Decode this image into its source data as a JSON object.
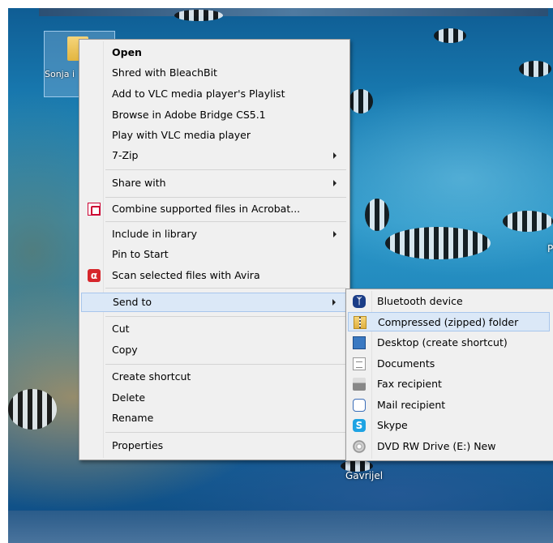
{
  "desktop": {
    "icons": [
      {
        "label": "Sonja i"
      },
      {
        "label": "Gavrijel"
      }
    ],
    "edge_label": "P"
  },
  "context_menu": {
    "items": [
      {
        "label": "Open",
        "bold": true
      },
      {
        "label": "Shred with BleachBit"
      },
      {
        "label": "Add to VLC media player's Playlist"
      },
      {
        "label": "Browse in Adobe Bridge CS5.1"
      },
      {
        "label": "Play with VLC media player"
      },
      {
        "label": "7-Zip",
        "submenu": true
      },
      {
        "label": "Share with",
        "submenu": true
      },
      {
        "label": "Combine supported files in Acrobat...",
        "icon": "acrobat-icon"
      },
      {
        "label": "Include in library",
        "submenu": true
      },
      {
        "label": "Pin to Start"
      },
      {
        "label": "Scan selected files with Avira",
        "icon": "avira-icon"
      },
      {
        "label": "Send to",
        "submenu": true,
        "highlighted": true
      },
      {
        "label": "Cut"
      },
      {
        "label": "Copy"
      },
      {
        "label": "Create shortcut"
      },
      {
        "label": "Delete"
      },
      {
        "label": "Rename"
      },
      {
        "label": "Properties"
      }
    ]
  },
  "send_to_menu": {
    "items": [
      {
        "label": "Bluetooth device",
        "icon": "bluetooth-icon"
      },
      {
        "label": "Compressed (zipped) folder",
        "icon": "zip-folder-icon",
        "highlighted": true
      },
      {
        "label": "Desktop (create shortcut)",
        "icon": "desktop-icon"
      },
      {
        "label": "Documents",
        "icon": "documents-icon"
      },
      {
        "label": "Fax recipient",
        "icon": "fax-icon"
      },
      {
        "label": "Mail recipient",
        "icon": "mail-icon"
      },
      {
        "label": "Skype",
        "icon": "skype-icon"
      },
      {
        "label": "DVD RW Drive (E:) New",
        "icon": "dvd-drive-icon"
      }
    ]
  },
  "colors": {
    "menu_bg": "#f0f0f0",
    "highlight_bg": "#dbe8f7",
    "highlight_border": "#a8c6ec",
    "separator": "#d4d4d4"
  }
}
